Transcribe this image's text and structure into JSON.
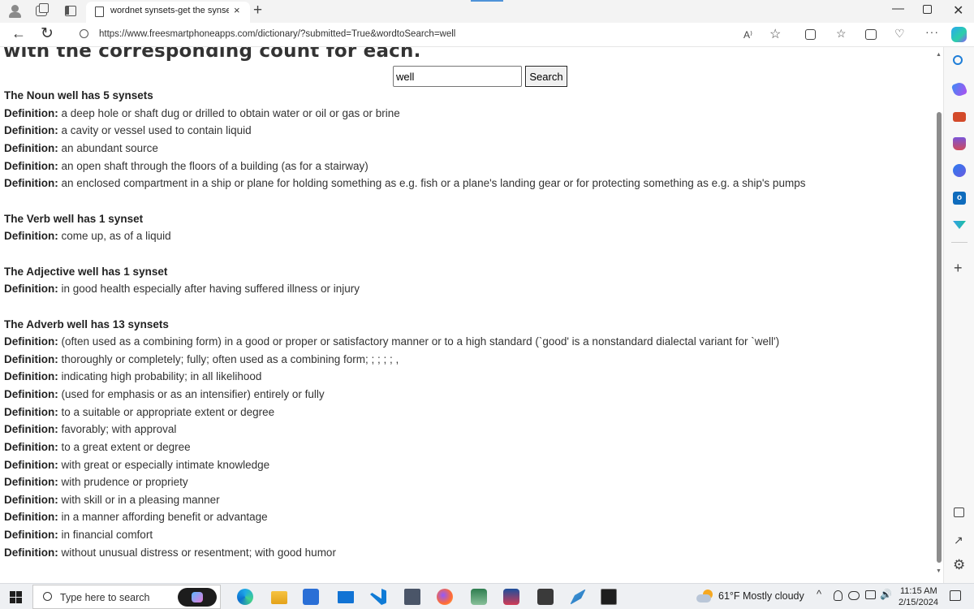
{
  "browser": {
    "tab_title": "wordnet synsets-get the synsets",
    "tab_close": "×",
    "new_tab": "+",
    "url": "https://www.freesmartphoneapps.com/dictionary/?submitted=True&wordtoSearch=well",
    "read_aloud": "A⁾",
    "favorite": "☆",
    "favorites_bar": "☆",
    "more": "···",
    "minimize": "—",
    "close": "✕",
    "back": "←",
    "refresh": "↻"
  },
  "page": {
    "clipped_heading": "with the corresponding count for each.",
    "search": {
      "value": "well",
      "button_label": "Search"
    },
    "definition_label": "Definition:",
    "sections": [
      {
        "title": "The Noun well has 5 synsets",
        "definitions": [
          "a deep hole or shaft dug or drilled to obtain water or oil or gas or brine",
          "a cavity or vessel used to contain liquid",
          "an abundant source",
          "an open shaft through the floors of a building (as for a stairway)",
          "an enclosed compartment in a ship or plane for holding something as e.g. fish or a plane's landing gear or for protecting something as e.g. a ship's pumps"
        ]
      },
      {
        "title": "The Verb well has 1 synset",
        "definitions": [
          "come up, as of a liquid"
        ]
      },
      {
        "title": "The Adjective well has 1 synset",
        "definitions": [
          "in good health especially after having suffered illness or injury"
        ]
      },
      {
        "title": "The Adverb well has 13 synsets",
        "definitions": [
          "(often used as a combining form) in a good or proper or satisfactory manner or to a high standard (`good' is a nonstandard dialectal variant for `well')",
          "thoroughly or completely; fully; often used as a combining form; ; ; ; ; ,",
          "indicating high probability; in all likelihood",
          "(used for emphasis or as an intensifier) entirely or fully",
          "to a suitable or appropriate extent or degree",
          "favorably; with approval",
          "to a great extent or degree",
          "with great or especially intimate knowledge",
          "with prudence or propriety",
          "with skill or in a pleasing manner",
          "in a manner affording benefit or advantage",
          "in financial comfort",
          "without unusual distress or resentment; with good humor"
        ]
      }
    ]
  },
  "sidebar": {
    "add": "+",
    "external": "↗",
    "settings": "⚙"
  },
  "taskbar": {
    "search_placeholder": "Type here to search",
    "weather": "61°F  Mostly cloudy",
    "tray_chevron": "^",
    "sound": "🔊",
    "time": "11:15 AM",
    "date": "2/15/2024"
  }
}
